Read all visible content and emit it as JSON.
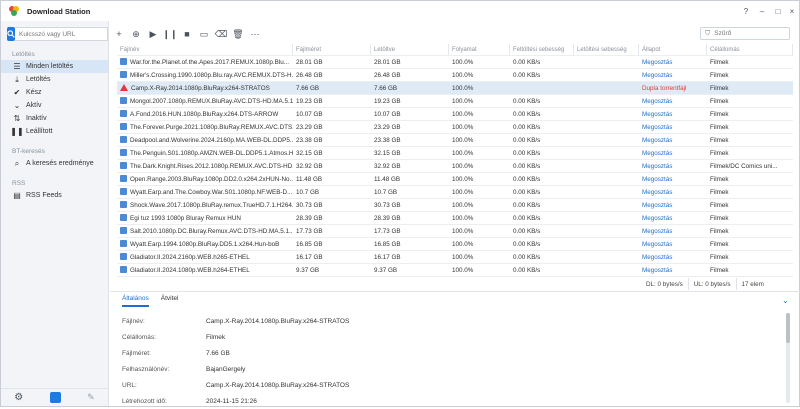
{
  "app": {
    "title": "Download Station",
    "help": "?",
    "minimize": "–",
    "maximize": "□",
    "close": "×"
  },
  "sidebar": {
    "search_placeholder": "Kulcsszó vagy URL",
    "sections": {
      "downloads": "Letöltés",
      "bt": "BT-keresés",
      "rss": "RSS"
    },
    "items": [
      {
        "label": "Minden letöltés",
        "icon": "list-icon"
      },
      {
        "label": "Letöltés",
        "icon": "download-arrow-icon"
      },
      {
        "label": "Kész",
        "icon": "check-icon"
      },
      {
        "label": "Aktív",
        "icon": "chevron-down-icon"
      },
      {
        "label": "Inaktív",
        "icon": "chevron-updown-icon"
      },
      {
        "label": "Leállított",
        "icon": "pause-icon"
      }
    ],
    "bt_item": "A keresés eredménye",
    "rss_item": "RSS Feeds"
  },
  "toolbar": {
    "filter_placeholder": "Szűrő"
  },
  "columns": [
    "Fájlnév",
    "Fájlméret",
    "Letöltve",
    "Folyamat",
    "Feltöltési sebesség",
    "Letöltési sebesség",
    "Állapot",
    "Célállomás"
  ],
  "rows": [
    [
      "War.for.the.Planet.of.the.Apes.2017.REMUX.1080p.Blu...",
      "28.01 GB",
      "28.01 GB",
      "100.0%",
      "0.00 KB/s",
      "",
      "Megosztás",
      "Filmek"
    ],
    [
      "Miller's.Crossing.1990.1080p.Blu.ray.AVC.REMUX.DTS-H...",
      "26.48 GB",
      "26.48 GB",
      "100.0%",
      "0.00 KB/s",
      "",
      "Megosztás",
      "Filmek"
    ],
    [
      "Camp.X-Ray.2014.1080p.BluRay.x264-STRATOS",
      "7.66 GB",
      "7.66 GB",
      "100.0%",
      "",
      "",
      "Dupla torrentfájl",
      "Filmek"
    ],
    [
      "Mongol.2007.1080p.REMUX.BluRay.AVC.DTS-HD.MA.5.1...",
      "19.23 GB",
      "19.23 GB",
      "100.0%",
      "0.00 KB/s",
      "",
      "Megosztás",
      "Filmek"
    ],
    [
      "A.Fond.2016.HUN.1080p.BluRay.x264.DTS-ARROW",
      "10.07 GB",
      "10.07 GB",
      "100.0%",
      "0.00 KB/s",
      "",
      "Megosztás",
      "Filmek"
    ],
    [
      "The.Forever.Purge.2021.1080p.BluRay.REMUX.AVC.DTS...",
      "23.29 GB",
      "23.29 GB",
      "100.0%",
      "0.00 KB/s",
      "",
      "Megosztás",
      "Filmek"
    ],
    [
      "Deadpool.and.Wolverine.2024.2160p.MA.WEB-DL.DDP5...",
      "23.38 GB",
      "23.38 GB",
      "100.0%",
      "0.00 KB/s",
      "",
      "Megosztás",
      "Filmek"
    ],
    [
      "The.Penguin.S01.1080p.AMZN.WEB-DL.DDP5.1.Atmos.H...",
      "32.15 GB",
      "32.15 GB",
      "100.0%",
      "0.00 KB/s",
      "",
      "Megosztás",
      "Filmek"
    ],
    [
      "The.Dark.Knight.Rises.2012.1080p.REMUX.AVC.DTS-HD...",
      "32.92 GB",
      "32.92 GB",
      "100.0%",
      "0.00 KB/s",
      "",
      "Megosztás",
      "Filmek/DC Comics uni..."
    ],
    [
      "Open.Range.2003.BluRay.1080p.DD2.0.x264.2xHUN-No...",
      "11.48 GB",
      "11.48 GB",
      "100.0%",
      "0.00 KB/s",
      "",
      "Megosztás",
      "Filmek"
    ],
    [
      "Wyatt.Earp.and.The.Cowboy.War.S01.1080p.NF.WEB-D...",
      "10.7 GB",
      "10.7 GB",
      "100.0%",
      "0.00 KB/s",
      "",
      "Megosztás",
      "Filmek"
    ],
    [
      "Shock.Wave.2017.1080p.BluRay.remux.TrueHD.7.1.H264...",
      "30.73 GB",
      "30.73 GB",
      "100.0%",
      "0.00 KB/s",
      "",
      "Megosztás",
      "Filmek"
    ],
    [
      "Egi tuz 1993 1080p Bluray Remux HUN",
      "28.39 GB",
      "28.39 GB",
      "100.0%",
      "0.00 KB/s",
      "",
      "Megosztás",
      "Filmek"
    ],
    [
      "Salt.2010.1080p.DC.Bluray.Remux.AVC.DTS-HD.MA.5.1...",
      "17.73 GB",
      "17.73 GB",
      "100.0%",
      "0.00 KB/s",
      "",
      "Megosztás",
      "Filmek"
    ],
    [
      "Wyatt.Earp.1994.1080p.BluRay.DD5.1.x264.Hun-boB",
      "16.85 GB",
      "16.85 GB",
      "100.0%",
      "0.00 KB/s",
      "",
      "Megosztás",
      "Filmek"
    ],
    [
      "Gladiator.II.2024.2160p.WEB.h265-ETHEL",
      "16.17 GB",
      "16.17 GB",
      "100.0%",
      "0.00 KB/s",
      "",
      "Megosztás",
      "Filmek"
    ],
    [
      "Gladiator.II.2024.1080p.WEB.h264-ETHEL",
      "9.37 GB",
      "9.37 GB",
      "100.0%",
      "0.00 KB/s",
      "",
      "Megosztás",
      "Filmek"
    ]
  ],
  "status": {
    "dl": "DL: 0 bytes/s",
    "ul": "UL: 0 bytes/s",
    "count": "17 elem"
  },
  "tabs": [
    "Általános",
    "Átvitel"
  ],
  "details": [
    {
      "k": "Fájlnév:",
      "v": "Camp.X-Ray.2014.1080p.BluRay.x264-STRATOS"
    },
    {
      "k": "Célállomás:",
      "v": "Filmek"
    },
    {
      "k": "Fájlméret:",
      "v": "7.66 GB"
    },
    {
      "k": "Felhasználónév:",
      "v": "BajanGergely"
    },
    {
      "k": "URL:",
      "v": "Camp.X-Ray.2014.1080p.BluRay.x264-STRATOS"
    },
    {
      "k": "Létrehozott idő:",
      "v": "2024-11-15 21:26"
    }
  ],
  "colors": {
    "accent": "#1e7be0",
    "error": "#e03b3b",
    "selected_row": "#dfeaf7"
  }
}
